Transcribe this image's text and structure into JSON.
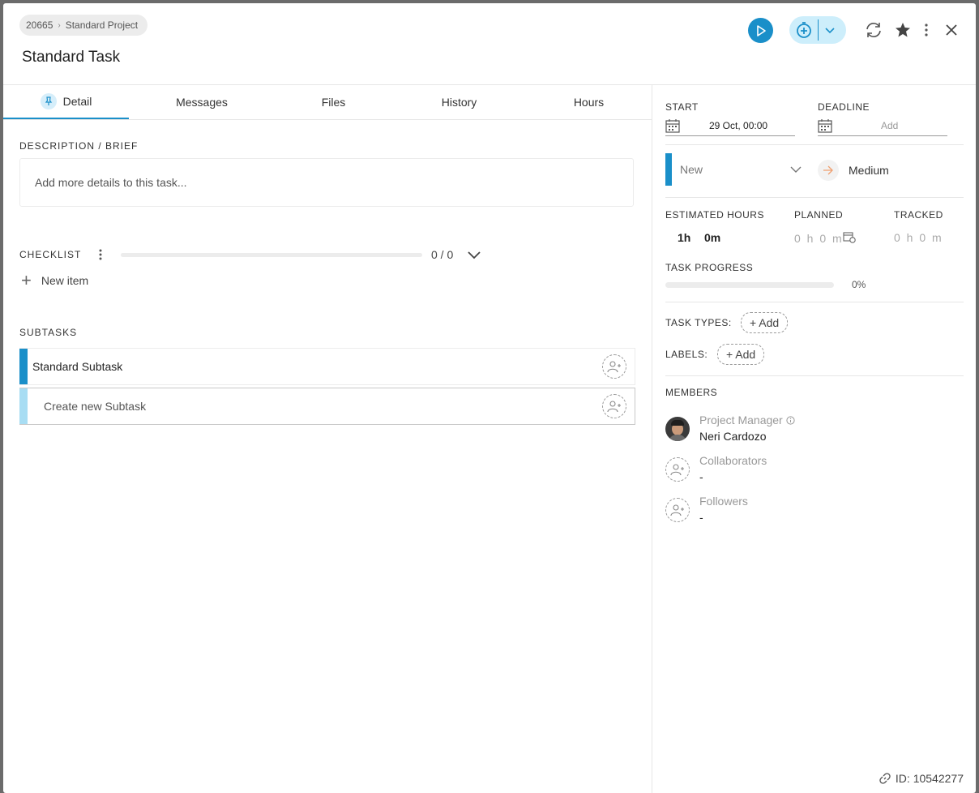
{
  "breadcrumb": {
    "project_id": "20665",
    "project_name": "Standard Project"
  },
  "task": {
    "title": "Standard Task",
    "id_label": "ID: 10542277"
  },
  "tabs": [
    {
      "label": "Detail",
      "active": true
    },
    {
      "label": "Messages"
    },
    {
      "label": "Files"
    },
    {
      "label": "History"
    },
    {
      "label": "Hours"
    }
  ],
  "description": {
    "label": "DESCRIPTION / BRIEF",
    "placeholder": "Add more details to this task..."
  },
  "checklist": {
    "label": "CHECKLIST",
    "count": "0 / 0",
    "progress": 0,
    "new_item": "New item"
  },
  "subtasks": {
    "label": "SUBTASKS",
    "items": [
      {
        "title": "Standard Subtask"
      }
    ],
    "create_placeholder": "Create new Subtask"
  },
  "dates": {
    "start_label": "START",
    "start_value": "29 Oct, 00:00",
    "deadline_label": "DEADLINE",
    "deadline_value": "Add"
  },
  "status": {
    "value": "New",
    "color": "#1a8fc9"
  },
  "priority": {
    "value": "Medium",
    "color": "#f0a070"
  },
  "hours": {
    "estimated_label": "ESTIMATED HOURS",
    "estimated_h": "1h",
    "estimated_m": "0m",
    "planned_label": "PLANNED",
    "planned_value": "0 h 0 m",
    "tracked_label": "TRACKED",
    "tracked_value": "0 h 0 m"
  },
  "progress": {
    "label": "TASK PROGRESS",
    "value": "0%",
    "fraction": 0
  },
  "task_types": {
    "label": "TASK TYPES:",
    "add": "+ Add"
  },
  "labels": {
    "label": "LABELS:",
    "add": "+ Add"
  },
  "members": {
    "label": "MEMBERS",
    "project_manager_role": "Project Manager",
    "project_manager_name": "Neri Cardozo",
    "collaborators_role": "Collaborators",
    "collaborators_value": "-",
    "followers_role": "Followers",
    "followers_value": "-"
  },
  "colors": {
    "accent": "#1a8fc9",
    "accent_light": "#cdeefb",
    "subtask_create_stripe": "#a8ddf3"
  }
}
